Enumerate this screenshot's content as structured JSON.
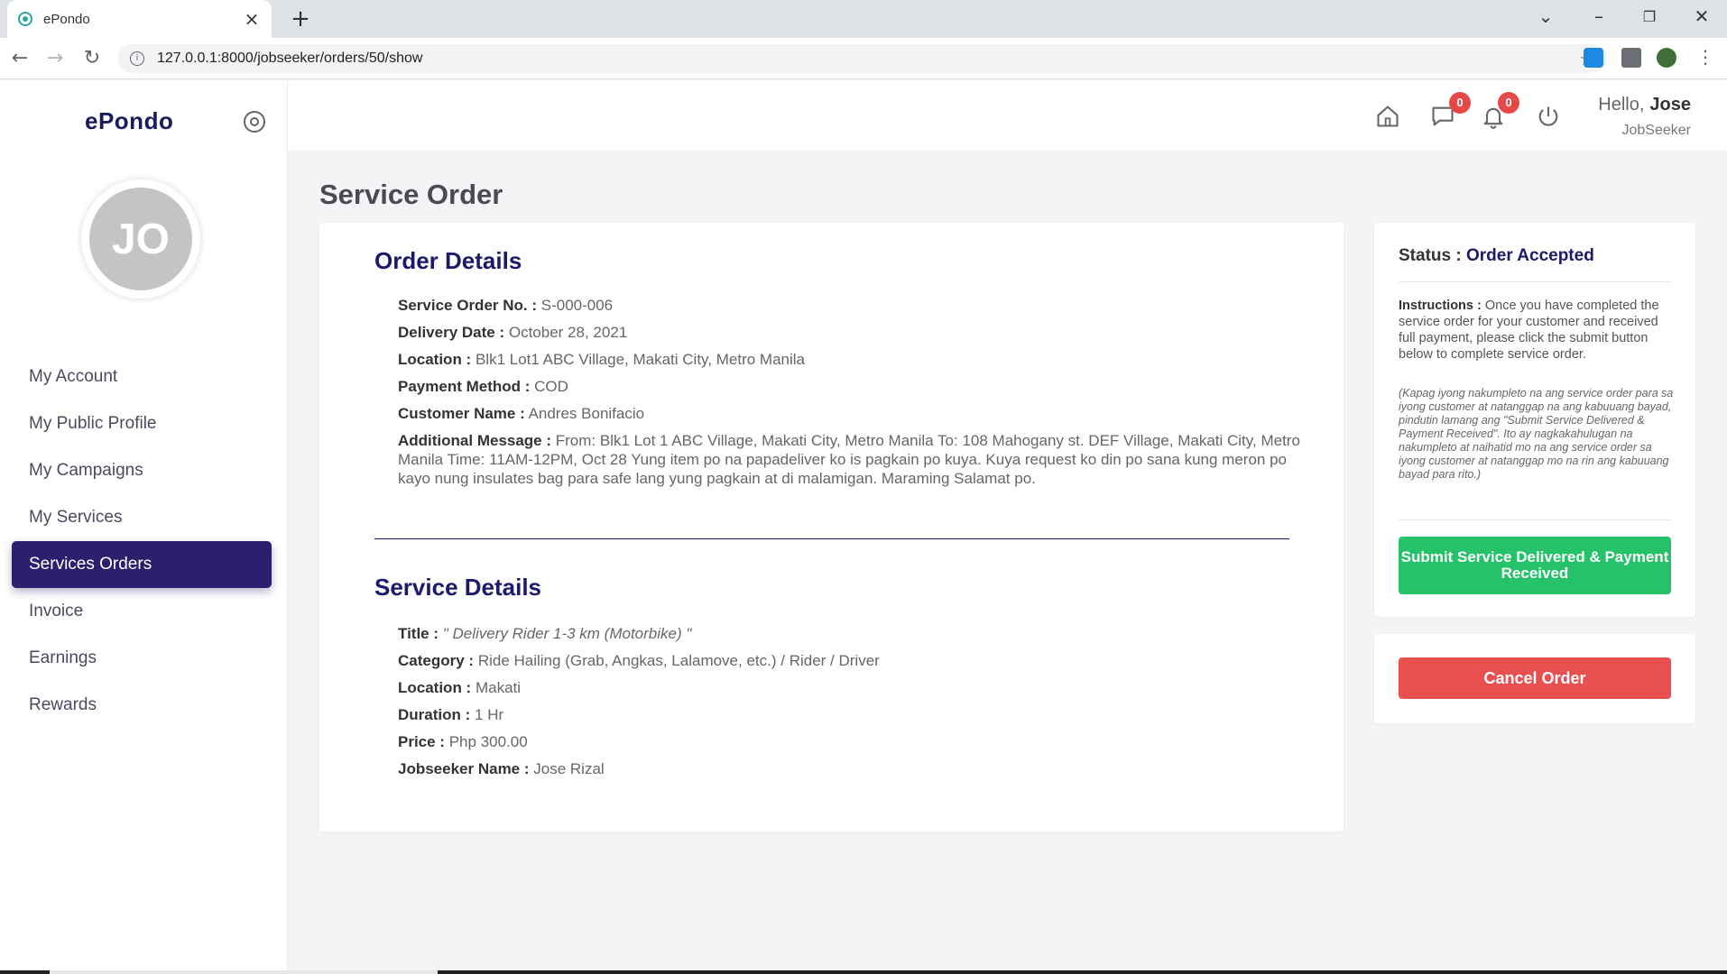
{
  "browser": {
    "tab_title": "ePondo",
    "url": "127.0.0.1:8000/jobseeker/orders/50/show",
    "new_tab": "+",
    "close_tab": "×"
  },
  "sidebar": {
    "brand": "ePondo",
    "avatar_initials": "JO",
    "items": [
      {
        "label": "My Account"
      },
      {
        "label": "My Public Profile"
      },
      {
        "label": "My Campaigns"
      },
      {
        "label": "My Services"
      },
      {
        "label": "Services Orders"
      },
      {
        "label": "Invoice"
      },
      {
        "label": "Earnings"
      },
      {
        "label": "Rewards"
      }
    ],
    "active_index": 4
  },
  "header": {
    "messages_count": "0",
    "notifications_count": "0",
    "greeting": "Hello,",
    "user_name": "Jose",
    "user_role": "JobSeeker"
  },
  "page": {
    "title": "Service Order"
  },
  "order_details": {
    "heading": "Order Details",
    "service_order_no_label": "Service Order No. :",
    "service_order_no": "S-000-006",
    "delivery_date_label": "Delivery Date :",
    "delivery_date": "October 28, 2021",
    "location_label": "Location :",
    "location": "Blk1 Lot1 ABC Village, Makati City, Metro Manila",
    "payment_method_label": "Payment Method :",
    "payment_method": "COD",
    "customer_name_label": "Customer Name :",
    "customer_name": "Andres Bonifacio",
    "additional_message_label": "Additional Message :",
    "additional_message": "From: Blk1 Lot 1 ABC Village, Makati City, Metro Manila To: 108 Mahogany st. DEF Village, Makati City, Metro Manila Time: 11AM-12PM, Oct 28 Yung item po na papadeliver ko is pagkain po kuya. Kuya request ko din po sana kung meron po kayo nung insulates bag para safe lang yung pagkain at di malamigan. Maraming Salamat po."
  },
  "service_details": {
    "heading": "Service Details",
    "title_label": "Title :",
    "title": "\" Delivery Rider 1-3 km (Motorbike) \"",
    "category_label": "Category :",
    "category": "Ride Hailing (Grab, Angkas, Lalamove, etc.) / Rider / Driver",
    "location_label": "Location :",
    "location": "Makati",
    "duration_label": "Duration :",
    "duration": "1 Hr",
    "price_label": "Price :",
    "price": "Php 300.00",
    "jobseeker_name_label": "Jobseeker Name :",
    "jobseeker_name": "Jose Rizal"
  },
  "status_panel": {
    "status_label": "Status :",
    "status_value": "Order Accepted",
    "instructions_label": "Instructions :",
    "instructions": "Once you have completed the service order for your customer and received full payment, please click the submit button below to complete service order.",
    "instructions_tl": "(Kapag iyong nakumpleto na ang service order para sa iyong customer at natanggap na ang kabuuang bayad, pindutin lamang ang \"Submit Service Delivered & Payment Received\". Ito ay nagkakahulugan na nakumpleto at naihatid mo na ang service order sa iyong customer at natanggap mo na rin ang kabuuang bayad para rito.)",
    "submit_label": "Submit Service Delivered & Payment Received",
    "cancel_label": "Cancel Order"
  },
  "colors": {
    "brand": "#1c1a6b",
    "active_nav": "#2b1f6e",
    "submit": "#26c26a",
    "cancel": "#e84f4f",
    "badge": "#e64848"
  }
}
